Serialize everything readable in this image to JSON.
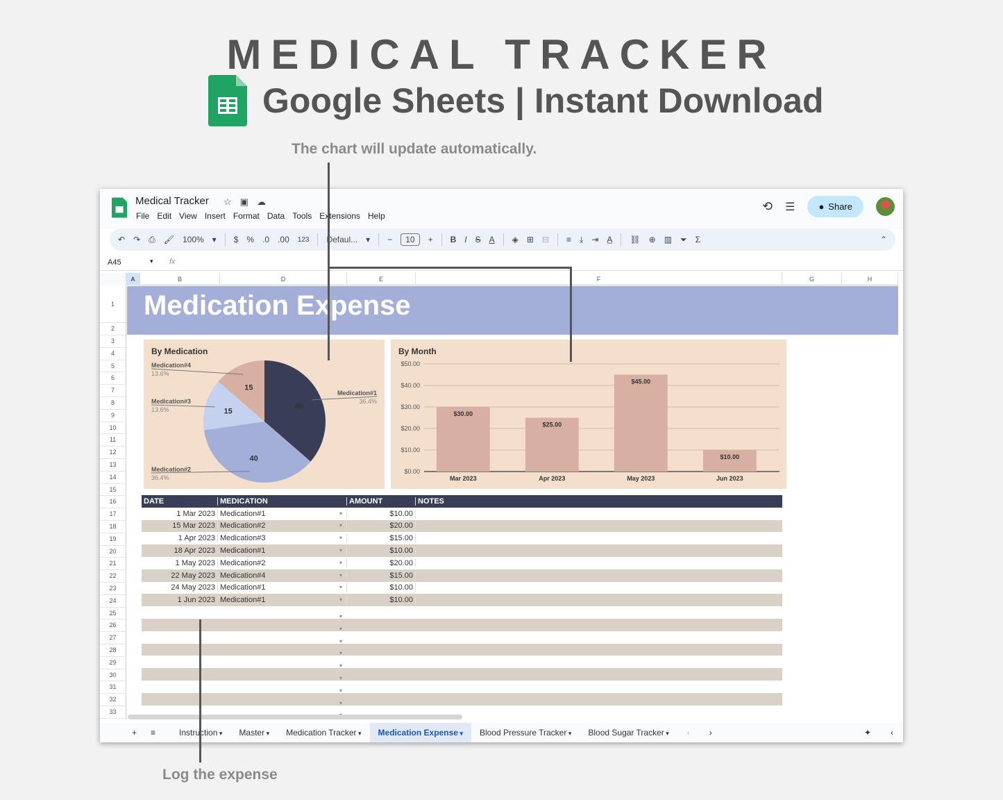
{
  "hero": {
    "title": "MEDICAL TRACKER",
    "subtitle": "Google Sheets | Instant Download"
  },
  "annotations": {
    "chart_note": "The chart will update automatically.",
    "log_note": "Log the expense"
  },
  "app": {
    "doc_title": "Medical Tracker",
    "menus": [
      "File",
      "Edit",
      "View",
      "Insert",
      "Format",
      "Data",
      "Tools",
      "Extensions",
      "Help"
    ],
    "share_label": "Share",
    "toolbar": {
      "zoom": "100%",
      "currency": "$",
      "percent": "%",
      "dec_less": ".0",
      "dec_more": ".00",
      "number_format": "123",
      "font": "Defaul...",
      "font_size": "10"
    },
    "cell_ref": "A45",
    "fx": "fx",
    "columns": [
      "A",
      "B",
      "D",
      "E",
      "F",
      "G",
      "H"
    ],
    "rows": [
      "1",
      "2",
      "3",
      "4",
      "5",
      "6",
      "7",
      "8",
      "9",
      "10",
      "11",
      "12",
      "13",
      "14",
      "15",
      "16",
      "17",
      "18",
      "19",
      "20",
      "21",
      "22",
      "23",
      "24",
      "25",
      "26",
      "27",
      "28",
      "29",
      "30",
      "31",
      "32",
      "33"
    ],
    "banner": "Medication Expense",
    "table": {
      "headers": [
        "DATE",
        "MEDICATION",
        "AMOUNT",
        "NOTES"
      ],
      "rows": [
        [
          "1 Mar 2023",
          "Medication#1",
          "$10.00",
          ""
        ],
        [
          "15 Mar 2023",
          "Medication#2",
          "$20.00",
          ""
        ],
        [
          "1 Apr 2023",
          "Medication#3",
          "$15.00",
          ""
        ],
        [
          "18 Apr 2023",
          "Medication#1",
          "$10.00",
          ""
        ],
        [
          "1 May 2023",
          "Medication#2",
          "$20.00",
          ""
        ],
        [
          "22 May 2023",
          "Medication#4",
          "$15.00",
          ""
        ],
        [
          "24 May 2023",
          "Medication#1",
          "$10.00",
          ""
        ],
        [
          "1 Jun 2023",
          "Medication#1",
          "$10.00",
          ""
        ],
        [
          "",
          "",
          "",
          ""
        ],
        [
          "",
          "",
          "",
          ""
        ],
        [
          "",
          "",
          "",
          ""
        ],
        [
          "",
          "",
          "",
          ""
        ],
        [
          "",
          "",
          "",
          ""
        ],
        [
          "",
          "",
          "",
          ""
        ],
        [
          "",
          "",
          "",
          ""
        ],
        [
          "",
          "",
          "",
          ""
        ],
        [
          "",
          "",
          "",
          ""
        ]
      ]
    },
    "sheet_tabs": [
      {
        "label": "Instruction",
        "active": false
      },
      {
        "label": "Master",
        "active": false
      },
      {
        "label": "Medication Tracker",
        "active": false
      },
      {
        "label": "Medication Expense",
        "active": true
      },
      {
        "label": "Blood Pressure Tracker",
        "active": false
      },
      {
        "label": "Blood Sugar Tracker",
        "active": false
      }
    ]
  },
  "chart_data": [
    {
      "type": "pie",
      "title": "By Medication",
      "slices": [
        {
          "label": "Medication#1",
          "value": 40,
          "percent": "36.4%",
          "color": "#393e56"
        },
        {
          "label": "Medication#2",
          "value": 40,
          "percent": "36.4%",
          "color": "#a3afd8"
        },
        {
          "label": "Medication#3",
          "value": 15,
          "percent": "13.6%",
          "color": "#c5d2ef"
        },
        {
          "label": "Medication#4",
          "value": 15,
          "percent": "13.6%",
          "color": "#d7b0a2"
        }
      ]
    },
    {
      "type": "bar",
      "title": "By Month",
      "categories": [
        "Mar 2023",
        "Apr 2023",
        "May 2023",
        "Jun 2023"
      ],
      "values": [
        30,
        25,
        45,
        10
      ],
      "labels": [
        "$30.00",
        "$25.00",
        "$45.00",
        "$10.00"
      ],
      "yticks": [
        "$0.00",
        "$10.00",
        "$20.00",
        "$30.00",
        "$40.00",
        "$50.00"
      ],
      "ylim": [
        0,
        50
      ],
      "bar_color": "#d7b0a2",
      "grid": true
    }
  ]
}
